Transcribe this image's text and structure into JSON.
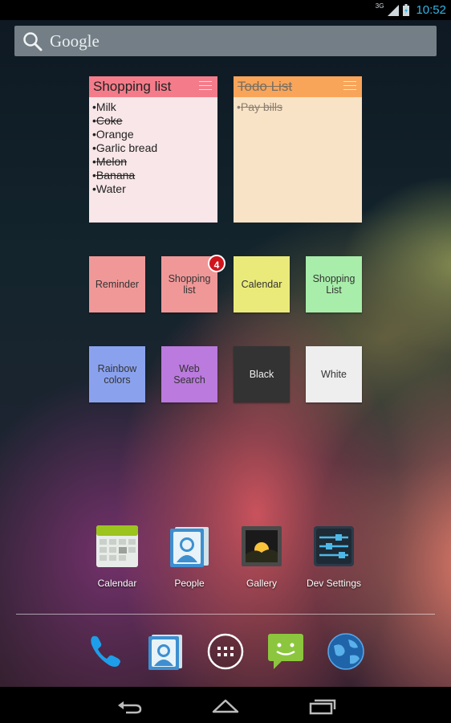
{
  "status_bar": {
    "network": "3G",
    "time": "10:52",
    "icons": [
      "signal-icon",
      "battery-charging-icon"
    ]
  },
  "search": {
    "placeholder": "Google",
    "icon": "search-icon"
  },
  "notes": [
    {
      "title": "Shopping list",
      "title_struck": false,
      "items": [
        {
          "text": "Milk",
          "struck": false
        },
        {
          "text": "Coke",
          "struck": true
        },
        {
          "text": "Orange",
          "struck": false
        },
        {
          "text": "Garlic bread",
          "struck": false
        },
        {
          "text": "Melon",
          "struck": true
        },
        {
          "text": "Banana",
          "struck": true
        },
        {
          "text": "Water",
          "struck": false
        }
      ],
      "color": "#f47c8a"
    },
    {
      "title": "Todo List",
      "title_struck": true,
      "items": [
        {
          "text": "Pay bills",
          "struck": true
        }
      ],
      "color": "#f8a55a"
    }
  ],
  "tiles_row1": [
    {
      "label": "Reminder",
      "color": "#f09898"
    },
    {
      "label": "Shopping list",
      "color": "#f09898",
      "badge": "4"
    },
    {
      "label": "Calendar",
      "color": "#eaea7a"
    },
    {
      "label": "Shopping List",
      "color": "#a8eeaa"
    }
  ],
  "tiles_row2": [
    {
      "label": "Rainbow colors",
      "color": "#8aa2ee"
    },
    {
      "label": "Web Search",
      "color": "#bb7ade"
    },
    {
      "label": "Black",
      "color": "#333333"
    },
    {
      "label": "White",
      "color": "#eeeeee"
    }
  ],
  "apps": [
    {
      "label": "Calendar",
      "icon": "calendar-icon"
    },
    {
      "label": "People",
      "icon": "people-icon"
    },
    {
      "label": "Gallery",
      "icon": "gallery-icon"
    },
    {
      "label": "Dev Settings",
      "icon": "dev-settings-icon"
    }
  ],
  "dock": [
    {
      "name": "phone-icon"
    },
    {
      "name": "contacts-icon"
    },
    {
      "name": "app-drawer-icon"
    },
    {
      "name": "messaging-icon"
    },
    {
      "name": "browser-icon"
    }
  ],
  "nav": [
    "back-icon",
    "home-icon",
    "recents-icon"
  ]
}
